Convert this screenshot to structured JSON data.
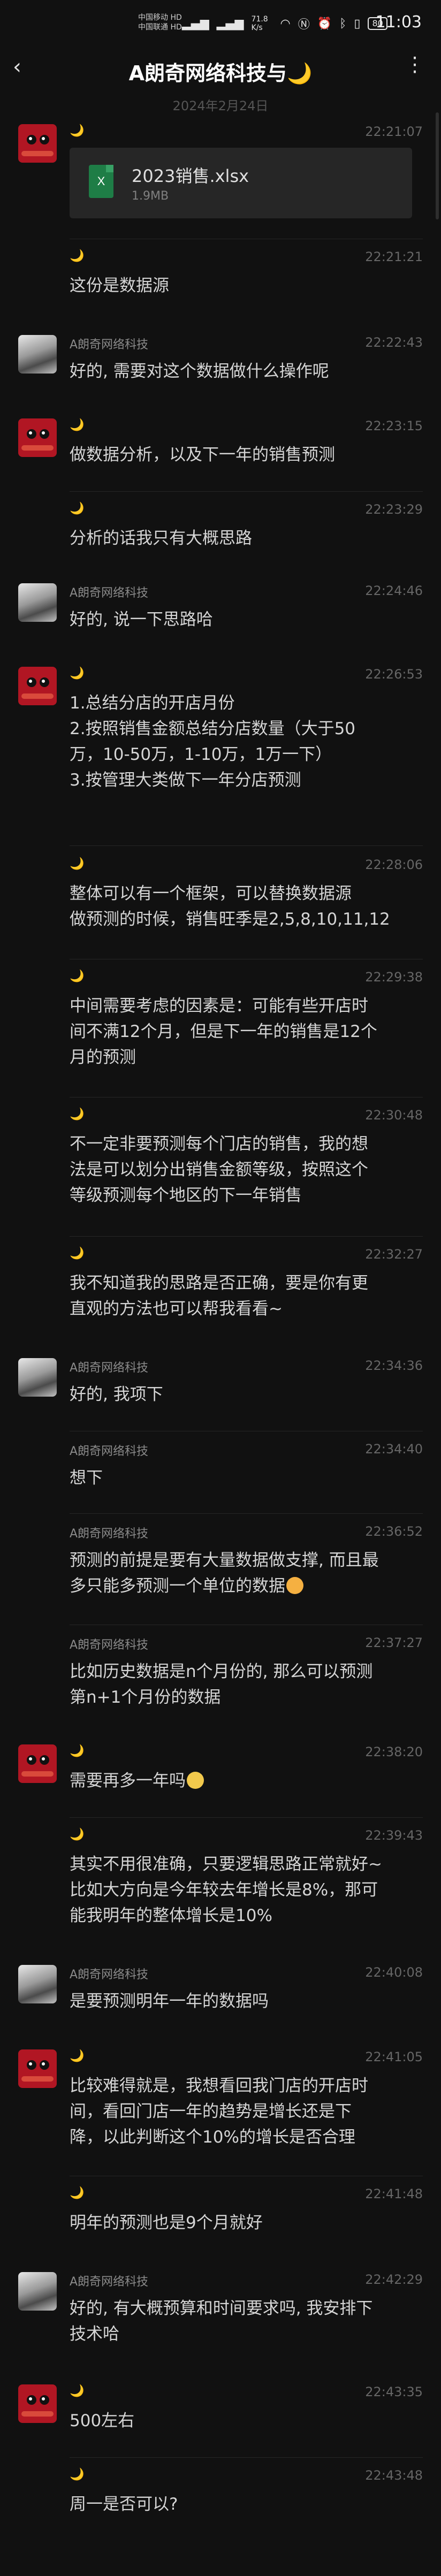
{
  "status_bar": {
    "carrier_1": "中国移动 HD",
    "carrier_2": "中国联通 HD",
    "speed": "71.8 K/s",
    "battery": "80",
    "time": "11:03",
    "icons": [
      "signal-icon",
      "signal-icon",
      "wifi-icon",
      "nfc-icon",
      "alarm-icon",
      "bluetooth-icon",
      "vibrate-icon",
      "battery-icon"
    ]
  },
  "header": {
    "back_icon": "‹",
    "title": "A朗奇网络科技与🌙",
    "more_icon": "⋮"
  },
  "date_divider": "2024年2月24日",
  "colors": {
    "background": "#111111",
    "text": "#d5d5d5",
    "timestamp": "#666666",
    "excel_green": "#1e7d46"
  },
  "messages": [
    {
      "sender": "🌙",
      "time": "22:21:07",
      "type": "file",
      "file_name": "2023销售.xlsx",
      "file_size": "1.9MB",
      "file_icon": "X",
      "avatar": "red"
    },
    {
      "sender": "🌙",
      "time": "22:21:21",
      "lines": [
        "这份是数据源"
      ],
      "avatar": "none"
    },
    {
      "sender": "A朗奇网络科技",
      "time": "22:22:43",
      "lines": [
        "好的, 需要对这个数据做什么操作呢"
      ],
      "avatar": "photo"
    },
    {
      "sender": "🌙",
      "time": "22:23:15",
      "lines": [
        "做数据分析，以及下一年的销售预测"
      ],
      "avatar": "red"
    },
    {
      "sender": "🌙",
      "time": "22:23:29",
      "lines": [
        "分析的话我只有大概思路"
      ],
      "avatar": "none"
    },
    {
      "sender": "A朗奇网络科技",
      "time": "22:24:46",
      "lines": [
        "好的, 说一下思路哈"
      ],
      "avatar": "photo"
    },
    {
      "sender": "🌙",
      "time": "22:26:53",
      "lines": [
        "1.总结分店的开店月份",
        "2.按照销售金额总结分店数量（大于50",
        "万，10-50万，1-10万，1万一下）",
        "3.按管理大类做下一年分店预测"
      ],
      "avatar": "red"
    },
    {
      "sender": "🌙",
      "time": "22:28:06",
      "lines": [
        "整体可以有一个框架，可以替换数据源",
        "做预测的时候，销售旺季是2,5,8,10,11,12"
      ],
      "avatar": "none"
    },
    {
      "sender": "🌙",
      "time": "22:29:38",
      "lines": [
        "中间需要考虑的因素是：可能有些开店时",
        "间不满12个月，但是下一年的销售是12个",
        "月的预测"
      ],
      "avatar": "none"
    },
    {
      "sender": "🌙",
      "time": "22:30:48",
      "lines": [
        "不一定非要预测每个门店的销售，我的想",
        "法是可以划分出销售金额等级，按照这个",
        "等级预测每个地区的下一年销售"
      ],
      "avatar": "none"
    },
    {
      "sender": "🌙",
      "time": "22:32:27",
      "lines": [
        "我不知道我的思路是否正确，要是你有更",
        "直观的方法也可以帮我看看~"
      ],
      "avatar": "none"
    },
    {
      "sender": "A朗奇网络科技",
      "time": "22:34:36",
      "lines": [
        "好的, 我项下"
      ],
      "avatar": "photo"
    },
    {
      "sender": "A朗奇网络科技",
      "time": "22:34:40",
      "lines": [
        "想下"
      ],
      "avatar": "none"
    },
    {
      "sender": "A朗奇网络科技",
      "time": "22:36:52",
      "lines": [
        "预测的前提是要有大量数据做支撑, 而且最",
        "多只能多预测一个单位的数据"
      ],
      "avatar": "none",
      "emoji": "sad"
    },
    {
      "sender": "A朗奇网络科技",
      "time": "22:37:27",
      "lines": [
        "比如历史数据是n个月份的, 那么可以预测",
        "第n+1个月份的数据"
      ],
      "avatar": "none"
    },
    {
      "sender": "🌙",
      "time": "22:38:20",
      "lines": [
        "需要再多一年吗"
      ],
      "avatar": "red",
      "emoji": "cat"
    },
    {
      "sender": "🌙",
      "time": "22:39:43",
      "lines": [
        "其实不用很准确，只要逻辑思路正常就好~",
        "比如大方向是今年较去年增长是8%，那可",
        "能我明年的整体增长是10%"
      ],
      "avatar": "none"
    },
    {
      "sender": "A朗奇网络科技",
      "time": "22:40:08",
      "lines": [
        "是要预测明年一年的数据吗"
      ],
      "avatar": "photo"
    },
    {
      "sender": "🌙",
      "time": "22:41:05",
      "lines": [
        "比较难得就是，我想看回我门店的开店时",
        "间，看回门店一年的趋势是增长还是下",
        "降，以此判断这个10%的增长是否合理"
      ],
      "avatar": "red"
    },
    {
      "sender": "🌙",
      "time": "22:41:48",
      "lines": [
        "明年的预测也是9个月就好"
      ],
      "avatar": "none"
    },
    {
      "sender": "A朗奇网络科技",
      "time": "22:42:29",
      "lines": [
        "好的, 有大概预算和时间要求吗, 我安排下",
        "技术哈"
      ],
      "avatar": "photo"
    },
    {
      "sender": "🌙",
      "time": "22:43:35",
      "lines": [
        "500左右"
      ],
      "avatar": "red"
    },
    {
      "sender": "🌙",
      "time": "22:43:48",
      "lines": [
        "周一是否可以?"
      ],
      "avatar": "none"
    }
  ]
}
